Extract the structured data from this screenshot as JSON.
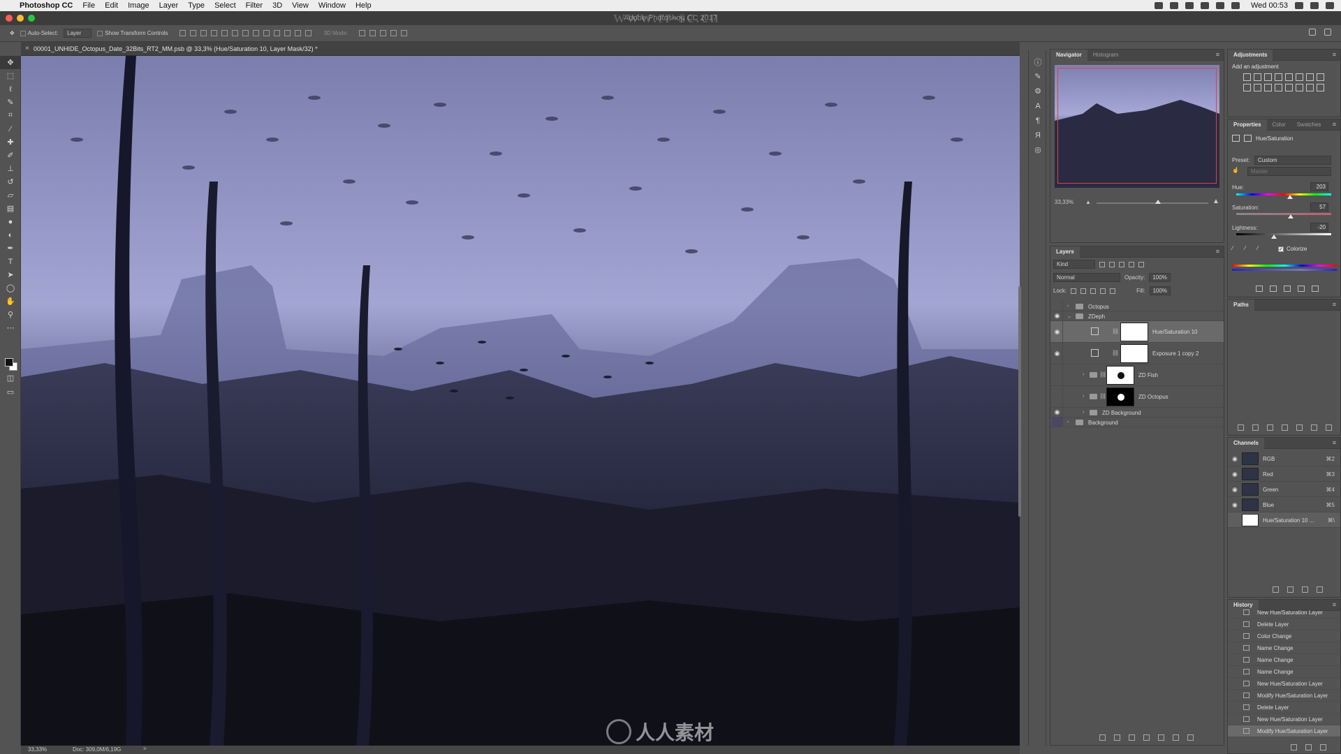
{
  "menubar": {
    "app_name": "Photoshop CC",
    "items": [
      "File",
      "Edit",
      "Image",
      "Layer",
      "Type",
      "Select",
      "Filter",
      "3D",
      "View",
      "Window",
      "Help"
    ],
    "clock": "Wed 00:53"
  },
  "window": {
    "title": "Adobe Photoshop CC 2017"
  },
  "options": {
    "auto_select_label": "Auto-Select:",
    "auto_select_value": "Layer",
    "show_transform_label": "Show Transform Controls",
    "mode_3d_label": "3D Mode:"
  },
  "document": {
    "tab_title": "00001_UNHIDE_Octopus_Date_32Bits_RT2_MM.psb @ 33,3% (Hue/Saturation 10, Layer Mask/32) *"
  },
  "statusbar": {
    "zoom": "33,33%",
    "doc_size": "Doc: 309,0M/6,19G",
    "arrow": ">"
  },
  "watermark": {
    "top": "www.rr-sc.cn",
    "bottom": "人人素材"
  },
  "navigator": {
    "tabs": [
      "Navigator",
      "Histogram"
    ],
    "zoom": "33,33%",
    "zoom_fraction": 0.55
  },
  "layers": {
    "tab": "Layers",
    "kind_label": "Kind",
    "blend_mode": "Normal",
    "opacity_label": "Opacity:",
    "opacity_value": "100%",
    "lock_label": "Lock:",
    "fill_label": "Fill:",
    "fill_value": "100%",
    "rows": [
      {
        "name": "Octopus",
        "kind": "group"
      },
      {
        "name": "ZDeph",
        "kind": "group"
      },
      {
        "name": "Hue/Saturation 10",
        "kind": "adjustment"
      },
      {
        "name": "Exposure 1 copy 2",
        "kind": "adjustment"
      },
      {
        "name": "ZD Fish",
        "kind": "masked-group"
      },
      {
        "name": "ZD Octopus",
        "kind": "masked-group"
      },
      {
        "name": "ZD Background",
        "kind": "group"
      },
      {
        "name": "Background",
        "kind": "group"
      }
    ]
  },
  "adjustments": {
    "tab": "Adjustments",
    "add_label": "Add an adjustment"
  },
  "properties": {
    "tabs": [
      "Properties",
      "Color",
      "Swatches"
    ],
    "layer_type": "Hue/Saturation",
    "preset_label": "Preset:",
    "preset_value": "Custom",
    "channel_value": "Master",
    "hue_label": "Hue:",
    "hue_value": "203",
    "saturation_label": "Saturation:",
    "saturation_value": "57",
    "lightness_label": "Lightness:",
    "lightness_value": "-20",
    "colorize_label": "Colorize",
    "colorize_checked": true
  },
  "paths": {
    "tab": "Paths"
  },
  "channels": {
    "tab": "Channels",
    "rows": [
      {
        "name": "RGB",
        "shortcut": "⌘2"
      },
      {
        "name": "Red",
        "shortcut": "⌘3"
      },
      {
        "name": "Green",
        "shortcut": "⌘4"
      },
      {
        "name": "Blue",
        "shortcut": "⌘5"
      },
      {
        "name": "Hue/Saturation 10 ...",
        "shortcut": "⌘\\"
      }
    ]
  },
  "history": {
    "tab": "History",
    "items": [
      "New Hue/Saturation Layer",
      "Delete Layer",
      "Color Change",
      "Name Change",
      "Name Change",
      "Name Change",
      "New Hue/Saturation Layer",
      "Modify Hue/Saturation Layer",
      "Delete Layer",
      "New Hue/Saturation Layer",
      "Modify Hue/Saturation Layer"
    ]
  },
  "colors": {
    "sky_top": "#7d80b0",
    "sky_bottom": "#a6a8d6",
    "deep": "#141422",
    "accent_selection": "#6a6a6a"
  }
}
